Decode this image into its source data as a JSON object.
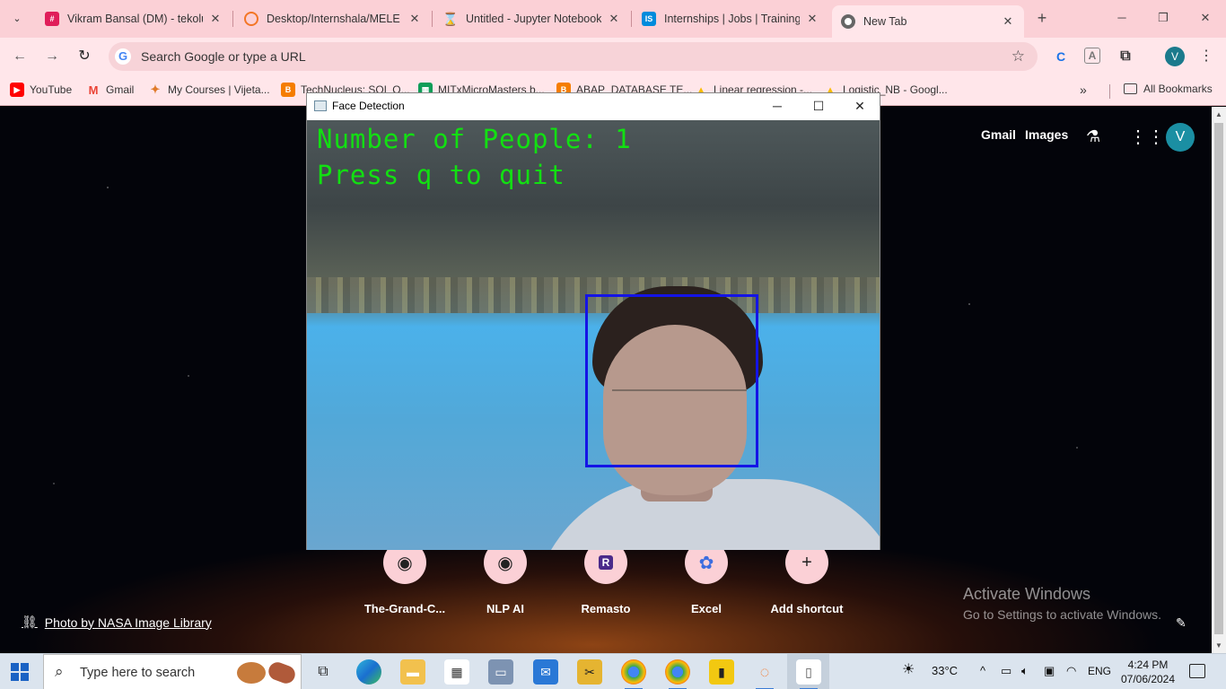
{
  "browser": {
    "tabs": [
      {
        "title": "Vikram Bansal (DM) - tekolu",
        "favicon": "slack-icon",
        "color": "#e01e5a"
      },
      {
        "title": "Desktop/Internshala/MELE (I",
        "favicon": "jupyter-icon",
        "color": "#f37626"
      },
      {
        "title": "Untitled - Jupyter Notebook",
        "favicon": "hourglass-icon",
        "color": "#f37626"
      },
      {
        "title": "Internships | Jobs | Trainings",
        "favicon": "internshala-icon",
        "color": "#008bdc"
      },
      {
        "title": "New Tab",
        "favicon": "chrome-icon",
        "color": "#555555"
      }
    ],
    "omnibox_placeholder": "Search Google or type a URL",
    "profile_letter": "V",
    "bookmarks": [
      {
        "label": "YouTube",
        "color": "#ff0000",
        "glyph": "▶"
      },
      {
        "label": "Gmail",
        "color": "#ea4335",
        "glyph": "M"
      },
      {
        "label": "My Courses | Vijeta...",
        "color": "#e07b2a",
        "glyph": "✦"
      },
      {
        "label": "TechNucleus: SQL Q...",
        "color": "#f57d00",
        "glyph": "B"
      },
      {
        "label": "MITxMicroMasters b...",
        "color": "#0f9d58",
        "glyph": "▦"
      },
      {
        "label": "ABAP_DATABASE TE...",
        "color": "#f57d00",
        "glyph": "B"
      },
      {
        "label": "Linear regression -...",
        "color": "#fbbc04",
        "glyph": "▲"
      },
      {
        "label": "Logistic_NB - Googl...",
        "color": "#fbbc04",
        "glyph": "▲"
      }
    ],
    "all_bookmarks_label": "All Bookmarks"
  },
  "ntp": {
    "gmail_label": "Gmail",
    "images_label": "Images",
    "avatar_letter": "V",
    "shortcuts": [
      {
        "label": "The-Grand-C...",
        "icon": "github-icon",
        "glyph": "◉"
      },
      {
        "label": "NLP AI",
        "icon": "github-icon",
        "glyph": "◉"
      },
      {
        "label": "Remasto",
        "icon": "remasto-icon",
        "glyph": "R"
      },
      {
        "label": "Excel",
        "icon": "copilot-icon",
        "glyph": "✿"
      },
      {
        "label": "Add shortcut",
        "icon": "plus-icon",
        "glyph": "+"
      }
    ],
    "photo_credit": "Photo by NASA Image Library",
    "activate_title": "Activate Windows",
    "activate_sub": "Go to Settings to activate Windows."
  },
  "face_window": {
    "title": "Face Detection",
    "line1": "Number of People: 1",
    "line2": "Press q to quit",
    "text_color": "#12e012",
    "box_color": "#1414e6"
  },
  "taskbar": {
    "search_placeholder": "Type here to search",
    "temperature": "33°C",
    "language": "ENG",
    "time": "4:24 PM",
    "date": "07/06/2024"
  }
}
